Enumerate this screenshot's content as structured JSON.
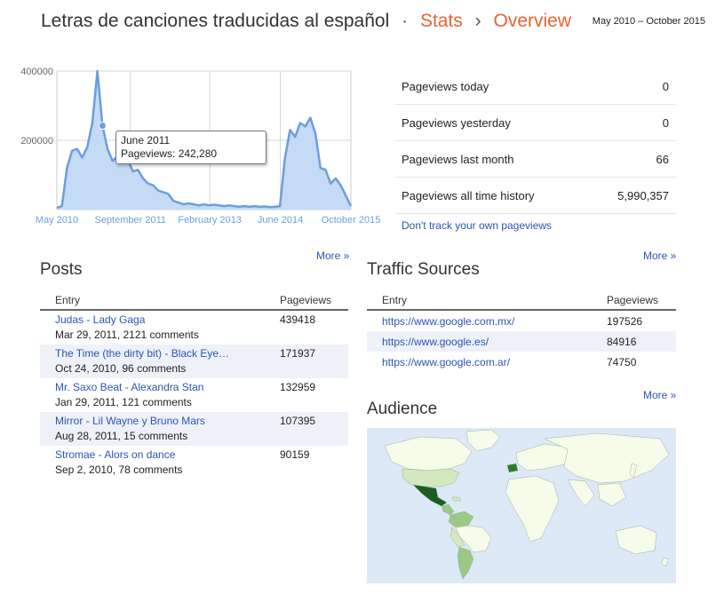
{
  "header": {
    "blog_title": "Letras de canciones traducidas al español",
    "separator": "·",
    "crumb_stats": "Stats",
    "crumb_arrow": "›",
    "crumb_overview": "Overview",
    "date_range": "May 2010 – October 2015"
  },
  "chart_data": {
    "type": "area",
    "title": "",
    "xlabel": "",
    "ylabel": "",
    "y_ticks": [
      "400000",
      "200000"
    ],
    "x_ticks": [
      "May 2010",
      "September 2011",
      "February 2013",
      "June 2014",
      "October 2015"
    ],
    "ylim": [
      0,
      400000
    ],
    "grid": true,
    "colors": {
      "line": "#6a9fdc",
      "fill": "#c5daf5"
    },
    "series": [
      {
        "values": [
          5000,
          10000,
          120000,
          170000,
          175000,
          150000,
          180000,
          250000,
          400000,
          242280,
          175000,
          140000,
          155000,
          135000,
          145000,
          110000,
          115000,
          90000,
          75000,
          70000,
          55000,
          50000,
          45000,
          25000,
          20000,
          15000,
          18000,
          15000,
          12000,
          15000,
          12000,
          14000,
          12000,
          10000,
          12000,
          10000,
          8000,
          10000,
          8000,
          10000,
          8000,
          9000,
          7000,
          8000,
          10000,
          150000,
          230000,
          210000,
          250000,
          240000,
          265000,
          220000,
          120000,
          115000,
          75000,
          90000,
          70000,
          40000,
          10000
        ]
      }
    ],
    "tooltip": {
      "label": "June 2011",
      "value_label": "Pageviews: 242,280",
      "value": 242280
    }
  },
  "stats": {
    "rows": [
      {
        "label": "Pageviews today",
        "value": "0"
      },
      {
        "label": "Pageviews yesterday",
        "value": "0"
      },
      {
        "label": "Pageviews last month",
        "value": "66"
      },
      {
        "label": "Pageviews all time history",
        "value": "5,990,357"
      }
    ],
    "dont_track_link": "Don't track your own pageviews"
  },
  "more_label": "More »",
  "posts": {
    "title": "Posts",
    "col_entry": "Entry",
    "col_pageviews": "Pageviews",
    "rows": [
      {
        "title": "Judas - Lady Gaga",
        "meta": "Mar 29, 2011, 2121 comments",
        "pageviews": "439418"
      },
      {
        "title": "The Time (the dirty bit) - Black Eye…",
        "meta": "Oct 24, 2010, 96 comments",
        "pageviews": "171937"
      },
      {
        "title": "Mr. Saxo Beat - Alexandra Stan",
        "meta": "Jan 29, 2011, 121 comments",
        "pageviews": "132959"
      },
      {
        "title": "Mirror - Lil Wayne y Bruno Mars",
        "meta": "Aug 28, 2011, 15 comments",
        "pageviews": "107395"
      },
      {
        "title": "Stromae - Alors on dance",
        "meta": "Sep 2, 2010, 78 comments",
        "pageviews": "90159"
      }
    ]
  },
  "traffic": {
    "title": "Traffic Sources",
    "col_entry": "Entry",
    "col_pageviews": "Pageviews",
    "rows": [
      {
        "url": "https://www.google.com.mx/",
        "pageviews": "197526"
      },
      {
        "url": "https://www.google.es/",
        "pageviews": "84916"
      },
      {
        "url": "https://www.google.com.ar/",
        "pageviews": "74750"
      }
    ]
  },
  "audience": {
    "title": "Audience",
    "colors": {
      "ocean": "#dde9f7",
      "land": "#f6fbea",
      "low": "#d3e8bf",
      "mid": "#9cc886",
      "high": "#2f7a2c",
      "top": "#1b5e20"
    }
  }
}
